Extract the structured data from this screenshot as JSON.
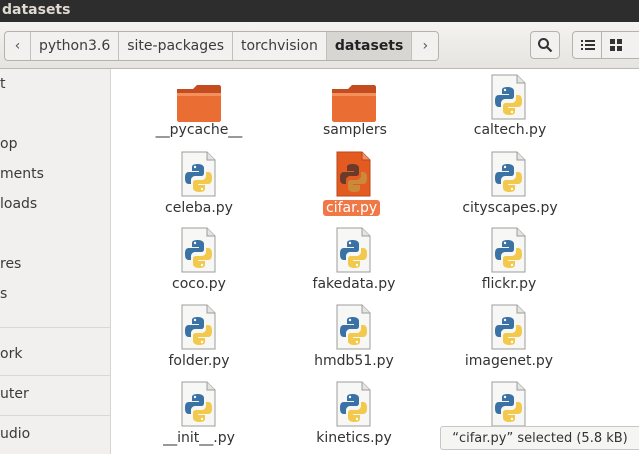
{
  "window": {
    "title": "datasets"
  },
  "pathbar": {
    "back_glyph": "‹",
    "forward_glyph": "›",
    "crumbs": [
      "python3.6",
      "site-packages",
      "torchvision",
      "datasets"
    ]
  },
  "toolbar": {
    "search_icon": "search-icon",
    "list_icon": "list-view-icon",
    "grid_icon": "grid-view-icon"
  },
  "sidebar": {
    "items": [
      "t",
      "",
      "op",
      "ments",
      "loads",
      "",
      "res",
      "s",
      "",
      "ork",
      "uter",
      "udio"
    ]
  },
  "files": [
    {
      "name": "__pycache__",
      "kind": "folder"
    },
    {
      "name": "samplers",
      "kind": "folder"
    },
    {
      "name": "caltech.py",
      "kind": "python"
    },
    {
      "name": "celeba.py",
      "kind": "python"
    },
    {
      "name": "cifar.py",
      "kind": "python",
      "selected": true
    },
    {
      "name": "cityscapes.py",
      "kind": "python"
    },
    {
      "name": "coco.py",
      "kind": "python"
    },
    {
      "name": "fakedata.py",
      "kind": "python"
    },
    {
      "name": "flickr.py",
      "kind": "python"
    },
    {
      "name": "folder.py",
      "kind": "python"
    },
    {
      "name": "hmdb51.py",
      "kind": "python"
    },
    {
      "name": "imagenet.py",
      "kind": "python"
    },
    {
      "name": "__init__.py",
      "kind": "python"
    },
    {
      "name": "kinetics.py",
      "kind": "python"
    },
    {
      "name": "",
      "kind": "python"
    }
  ],
  "status": {
    "text": "“cifar.py” selected  (5.8 kB)"
  },
  "colors": {
    "selection": "#f07746",
    "titlebar": "#2d2d2d",
    "folder": "#e8622b"
  }
}
